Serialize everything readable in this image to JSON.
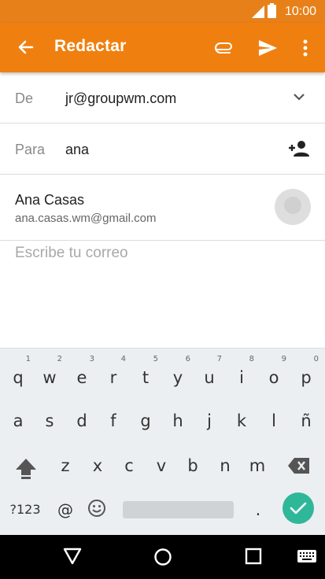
{
  "status_bar": {
    "time": "10:00"
  },
  "app_bar": {
    "title": "Redactar",
    "color": "#ef8010",
    "icons": [
      "back-arrow-icon",
      "attach-icon",
      "send-icon",
      "more-vert-icon"
    ]
  },
  "compose": {
    "from_label": "De",
    "from_value": "jr@groupwm.com",
    "to_label": "Para",
    "to_value": "ana",
    "suggestion": {
      "name": "Ana Casas",
      "email": "ana.casas.wm@gmail.com"
    },
    "body_placeholder": "Escribe tu correo"
  },
  "keyboard": {
    "row1": [
      {
        "key": "q",
        "hint": "1"
      },
      {
        "key": "w",
        "hint": "2"
      },
      {
        "key": "e",
        "hint": "3"
      },
      {
        "key": "r",
        "hint": "4"
      },
      {
        "key": "t",
        "hint": "5"
      },
      {
        "key": "y",
        "hint": "6"
      },
      {
        "key": "u",
        "hint": "7"
      },
      {
        "key": "i",
        "hint": "8"
      },
      {
        "key": "o",
        "hint": "9"
      },
      {
        "key": "p",
        "hint": "0"
      }
    ],
    "row2": [
      "a",
      "s",
      "d",
      "f",
      "g",
      "h",
      "j",
      "k",
      "l",
      "ñ"
    ],
    "row3": [
      "z",
      "x",
      "c",
      "v",
      "b",
      "n",
      "m"
    ],
    "symbols_label": "?123",
    "at_label": "@",
    "period_label": ".",
    "accent_color": "#2fb79a"
  }
}
